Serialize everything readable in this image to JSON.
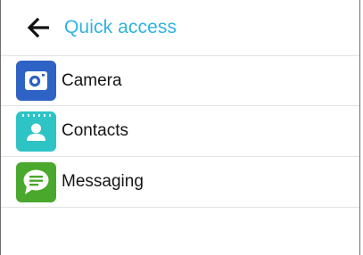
{
  "header": {
    "title": "Quick access",
    "back_icon": "arrow-left-icon",
    "title_color": "#2fb3e0"
  },
  "items": [
    {
      "label": "Camera",
      "icon": "camera-icon",
      "color": "#2e62c4"
    },
    {
      "label": "Contacts",
      "icon": "contacts-icon",
      "color": "#2ec4c6"
    },
    {
      "label": "Messaging",
      "icon": "messaging-icon",
      "color": "#4aa82c"
    }
  ]
}
